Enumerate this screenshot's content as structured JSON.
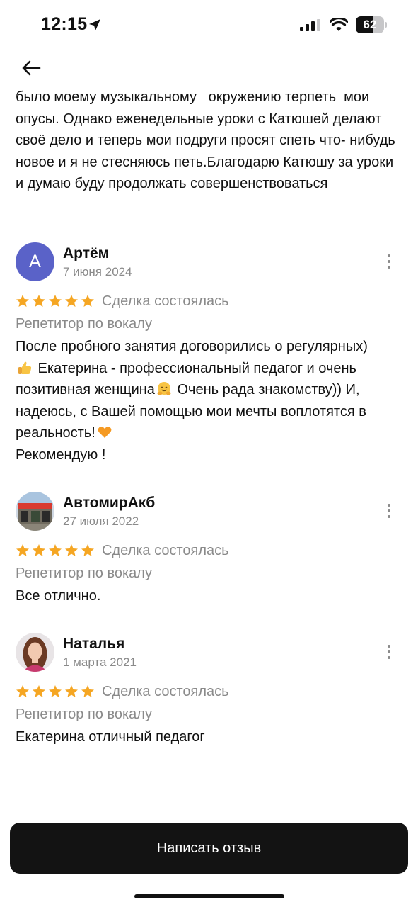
{
  "status_bar": {
    "time": "12:15",
    "battery_level": "62",
    "battery_fraction": 0.62
  },
  "previous_review_text": "было моему музыкальному   окружению терпеть  мои опусы. Однако еженедельные уроки с Катюшей делают своё дело и теперь мои подруги просят спеть что- нибудь новое и я не стесняюсь петь.Благодарю Катюшу за уроки и думаю буду продолжать совершенствоваться",
  "reviews": [
    {
      "avatar_letter": "А",
      "avatar_color": "#5a62c8",
      "name": "Артём",
      "date": "7 июня 2024",
      "stars": 5,
      "deal": "Сделка состоялась",
      "category": "Репетитор по вокалу",
      "text_1": "После пробного занятия договорились о регулярных)",
      "text_2": " Екатерина - профессиональный педагог и очень позитивная женщина",
      "text_3": " Очень рада знакомству)) И, надеюсь, с Вашей помощью мои мечты воплотятся в реальность!",
      "text_4": "Рекомендую !",
      "emojis": [
        "thumbs-up-icon",
        "hugging-face-icon",
        "orange-heart-icon"
      ]
    },
    {
      "name": "АвтомирАкб",
      "date": "27 июля 2022",
      "stars": 5,
      "deal": "Сделка состоялась",
      "category": "Репетитор по вокалу",
      "text": "Все отлично."
    },
    {
      "name": "Наталья",
      "date": "1 марта 2021",
      "stars": 5,
      "deal": "Сделка состоялась",
      "category": "Репетитор по вокалу",
      "text": "Екатерина отличный педагог"
    }
  ],
  "bottom": {
    "write_review_label": "Написать отзыв"
  },
  "colors": {
    "star": "#f5a623",
    "secondary_text": "#8a8a8a",
    "button_bg": "#131313"
  }
}
